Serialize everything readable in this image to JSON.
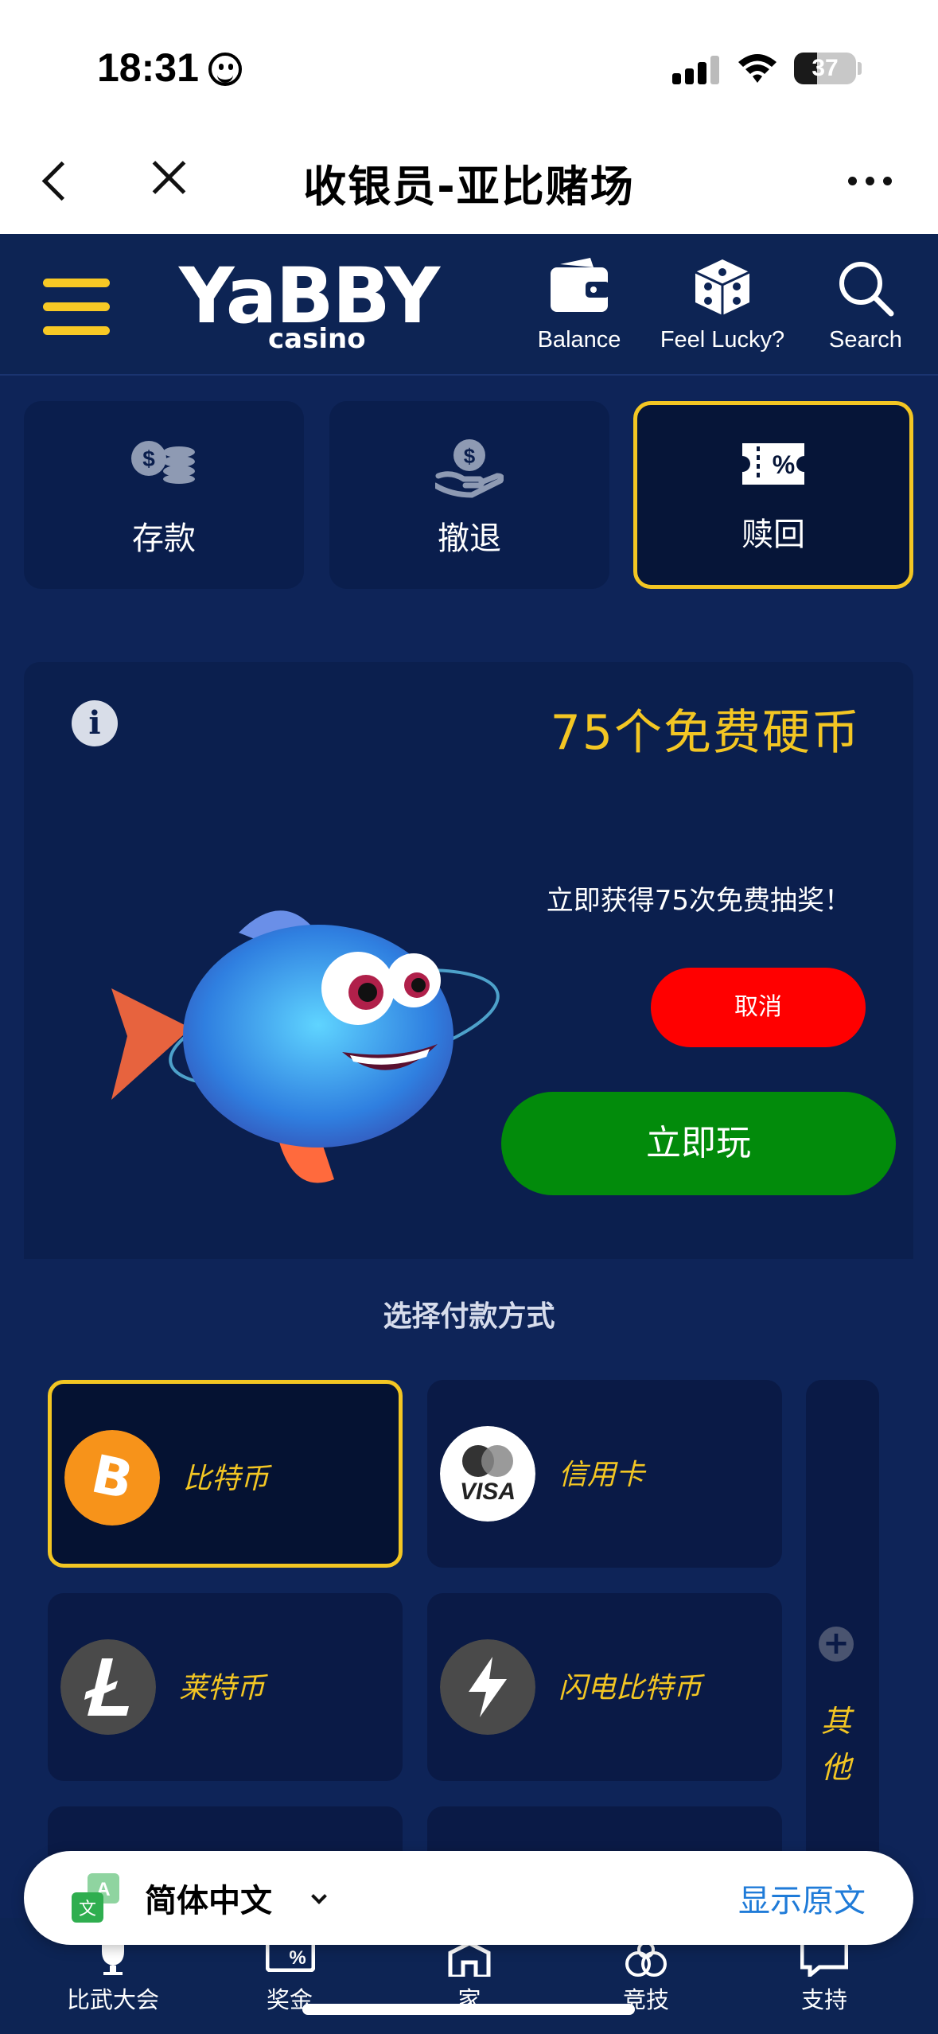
{
  "status": {
    "time": "18:31",
    "battery": "37"
  },
  "nav": {
    "title": "收银员-亚比赌场"
  },
  "header": {
    "logo_main": "YaBBY",
    "logo_sub": "casino",
    "balance": "Balance",
    "lucky": "Feel Lucky?",
    "search": "Search",
    "accent": "#f7c925"
  },
  "tabs": [
    {
      "label": "存款",
      "icon": "coins-icon"
    },
    {
      "label": "撤退",
      "icon": "hand-money-icon"
    },
    {
      "label": "赎回",
      "icon": "coupon-percent-icon",
      "active": true
    }
  ],
  "promo": {
    "title": "75个免费硬币",
    "description": "立即获得75次免费抽奖！",
    "cancel": "取消",
    "play": "立即玩"
  },
  "payment": {
    "title": "选择付款方式",
    "methods": [
      {
        "label": "比特币",
        "icon": "bitcoin-icon",
        "selected": true
      },
      {
        "label": "信用卡",
        "icon": "visa-mastercard-icon"
      },
      {
        "label": "莱特币",
        "icon": "litecoin-icon"
      },
      {
        "label": "闪电比特币",
        "icon": "lightning-icon"
      }
    ],
    "other": "其他"
  },
  "bottom_nav": [
    {
      "label": "比武大会"
    },
    {
      "label": "奖金"
    },
    {
      "label": "家"
    },
    {
      "label": "竞技"
    },
    {
      "label": "支持"
    }
  ],
  "translate": {
    "language": "简体中文",
    "show_original": "显示原文"
  }
}
